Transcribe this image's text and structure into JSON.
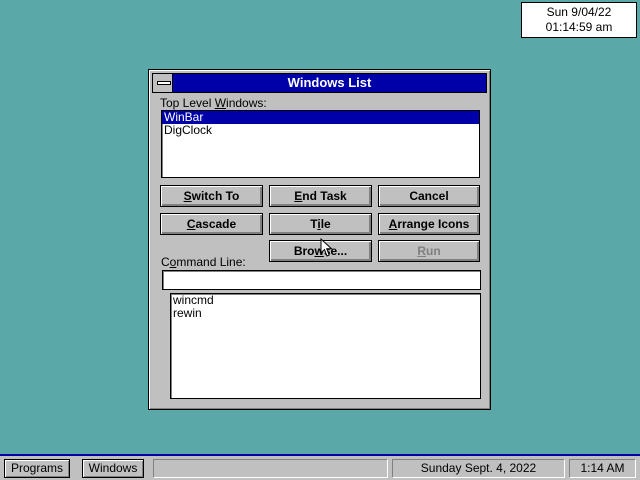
{
  "clock": {
    "line1": "Sun  9/04/22",
    "line2": "01:14:59 am"
  },
  "dialog": {
    "title": "Windows List",
    "top_label_pre": "Top Level ",
    "top_label_u": "W",
    "top_label_post": "indows:",
    "top_windows": [
      "WinBar",
      "DigClock"
    ],
    "buttons": {
      "switch_u": "S",
      "switch_rest": "witch To",
      "end_u": "E",
      "end_rest": "nd Task",
      "cancel": "Cancel",
      "cascade_u": "C",
      "cascade_rest": "ascade",
      "tile_pre": "T",
      "tile_u": "i",
      "tile_rest": "le",
      "arrange_u": "A",
      "arrange_rest": "rrange Icons",
      "browse_pre": "Bro",
      "browse_u": "w",
      "browse_rest": "se...",
      "run_u": "R",
      "run_rest": "un"
    },
    "command_label_pre": "C",
    "command_label_u": "o",
    "command_label_post": "mmand Line:",
    "command_value": "",
    "history": [
      "wincmd",
      "rewin"
    ]
  },
  "taskbar": {
    "programs": "Programs",
    "windows": "Windows",
    "date": "Sunday Sept. 4, 2022",
    "time": "1:14 AM"
  },
  "colors": {
    "desktop": "#5ba8a8",
    "title_active": "#0000a8",
    "selection": "#0000a8"
  },
  "icons": {
    "cursor": "arrow-cursor-icon",
    "system_menu": "system-menu-icon"
  }
}
